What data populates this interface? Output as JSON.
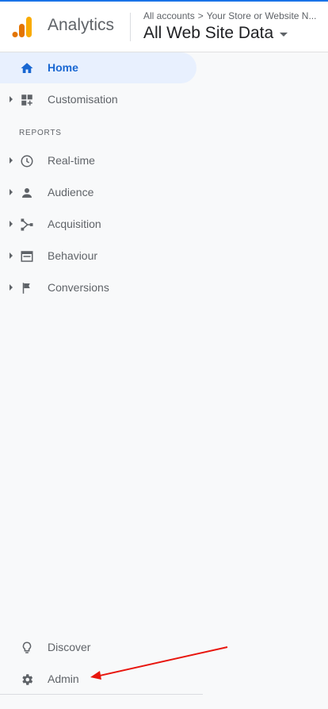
{
  "header": {
    "product_name": "Analytics",
    "breadcrumb": {
      "account": "All accounts",
      "separator": ">",
      "property": "Your Store or Website N..."
    },
    "view_name": "All Web Site Data",
    "colors": {
      "accent": "#1a73e8",
      "logo_orange": "#f9ab00",
      "logo_dark": "#e37400"
    }
  },
  "sidebar": {
    "top_items": [
      {
        "label": "Home",
        "icon": "home-icon",
        "active": true
      },
      {
        "label": "Customisation",
        "icon": "dashboard-grid-icon",
        "expandable": true
      }
    ],
    "section_label": "REPORTS",
    "report_items": [
      {
        "label": "Real-time",
        "icon": "clock-icon"
      },
      {
        "label": "Audience",
        "icon": "person-icon"
      },
      {
        "label": "Acquisition",
        "icon": "acquisition-icon"
      },
      {
        "label": "Behaviour",
        "icon": "behaviour-icon"
      },
      {
        "label": "Conversions",
        "icon": "flag-icon"
      }
    ],
    "bottom_items": [
      {
        "label": "Discover",
        "icon": "lightbulb-icon"
      },
      {
        "label": "Admin",
        "icon": "gear-icon"
      }
    ],
    "active_color": "#1967d2",
    "annotation_color": "#e8150d"
  }
}
